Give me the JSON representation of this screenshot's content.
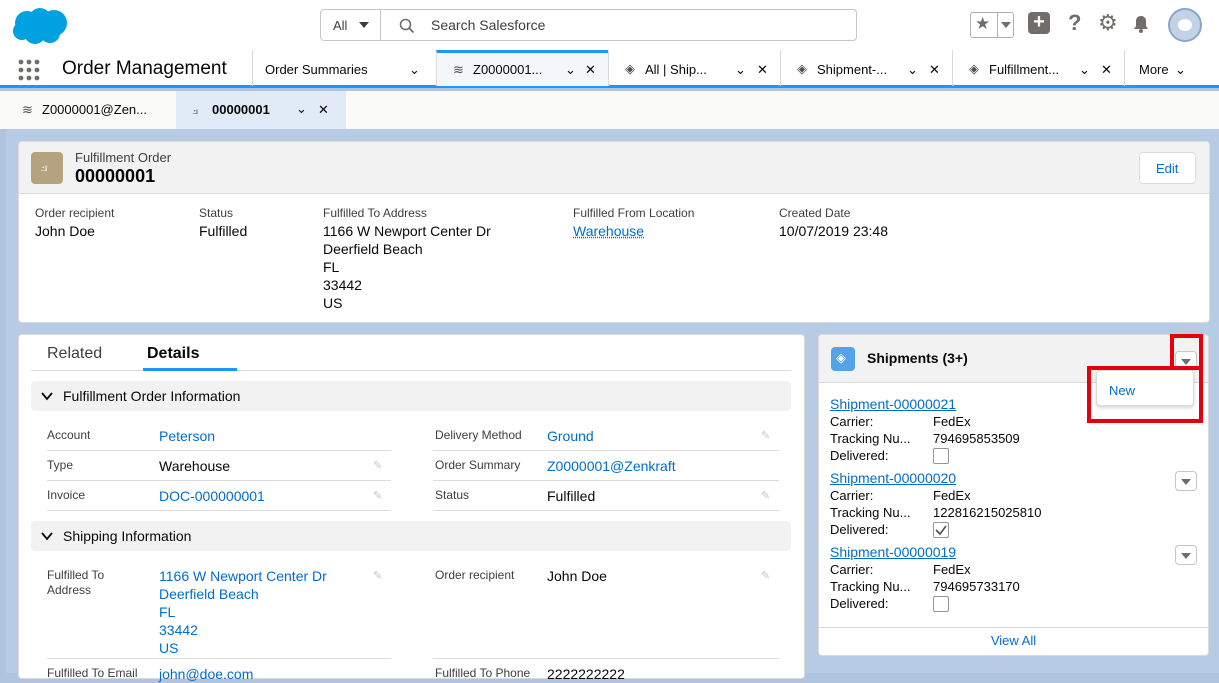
{
  "header": {
    "search_scope": "All",
    "search_placeholder": "Search Salesforce"
  },
  "nav": {
    "app_name": "Order Management",
    "tabs": [
      {
        "label": "Order Summaries"
      },
      {
        "label": "Z0000001..."
      },
      {
        "label": "All | Ship..."
      },
      {
        "label": "Shipment-..."
      },
      {
        "label": "Fulfillment..."
      },
      {
        "label": "More"
      }
    ]
  },
  "subtabs": [
    {
      "label": "Z0000001@Zen..."
    },
    {
      "label": "00000001"
    }
  ],
  "record": {
    "object_type": "Fulfillment Order",
    "title": "00000001",
    "edit_label": "Edit",
    "highlights": [
      {
        "label": "Order recipient",
        "value": "John Doe"
      },
      {
        "label": "Status",
        "value": "Fulfilled"
      },
      {
        "label": "Fulfilled To Address",
        "lines": [
          "1166 W Newport Center Dr",
          "Deerfield Beach",
          "FL",
          "33442",
          "US"
        ]
      },
      {
        "label": "Fulfilled From Location",
        "value": "Warehouse"
      },
      {
        "label": "Created Date",
        "value": "10/07/2019 23:48"
      }
    ]
  },
  "details": {
    "tabs": [
      "Related",
      "Details"
    ],
    "section1": "Fulfillment Order Information",
    "fields": {
      "account_label": "Account",
      "account": "Peterson",
      "type_label": "Type",
      "type": "Warehouse",
      "invoice_label": "Invoice",
      "invoice": "DOC-000000001",
      "delivery_label": "Delivery Method",
      "delivery": "Ground",
      "summary_label": "Order Summary",
      "summary": "Z0000001@Zenkraft",
      "status_label": "Status",
      "status": "Fulfilled"
    },
    "section2": "Shipping Information",
    "ship": {
      "to_addr_label1": "Fulfilled To",
      "to_addr_label2": "Address",
      "addr": [
        "1166 W Newport Center Dr",
        "Deerfield Beach",
        "FL",
        "33442",
        "US"
      ],
      "recipient_label": "Order recipient",
      "recipient": "John Doe",
      "email_label": "Fulfilled To Email",
      "email": "john@doe.com",
      "phone_label": "Fulfilled To Phone",
      "phone": "2222222222"
    }
  },
  "shipments": {
    "title": "Shipments (3+)",
    "menu_new": "New",
    "view_all": "View All",
    "carrier_label": "Carrier:",
    "tracking_label": "Tracking Nu...",
    "delivered_label": "Delivered:",
    "items": [
      {
        "name": "Shipment-00000021",
        "carrier": "FedEx",
        "tracking": "794695853509",
        "delivered": false
      },
      {
        "name": "Shipment-00000020",
        "carrier": "FedEx",
        "tracking": "122816215025810",
        "delivered": true
      },
      {
        "name": "Shipment-00000019",
        "carrier": "FedEx",
        "tracking": "794695733170",
        "delivered": false
      }
    ]
  },
  "colors": {
    "brand": "#1b96ff",
    "link": "#006dcc",
    "highlight": "#e4000d"
  }
}
